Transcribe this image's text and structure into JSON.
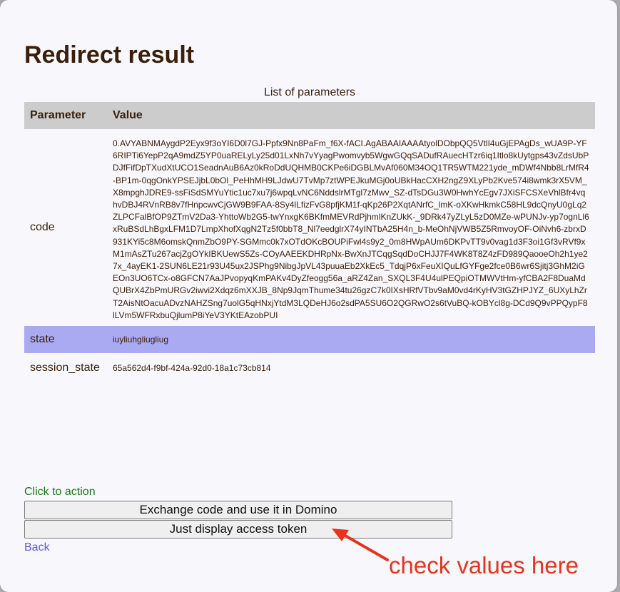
{
  "page": {
    "title": "Redirect result"
  },
  "table": {
    "caption": "List of parameters",
    "headers": [
      "Parameter",
      "Value"
    ],
    "rows": [
      {
        "name": "code",
        "value": "0.AVYABNMAygdP2Eyx9f3oYI6D0l7GJ-Ppfx9Nn8PaFm_f6X-fACI.AgABAAIAAAAtyolDObpQQ5VtlI4uGjEPAgDs_wUA9P-YF6RIPTi6YepP2qA9mdZ5YP0uaRELyLy25d01LxNh7vYyagPwomvyb5WgwGQqSADufRAuecHTzr6iq1Itlo8kUytgps43vZdsUbPDJfFifDpTXudXtUCO1SeadnAuB6Az0kRoDdUQHMB0CKPe6iDGBLMvAf060M34OQ1TR5WTM221yde_mDWf4Nbb8LrMfR4-BP1m-0qgOnkYPSEJjbL0bOl_PeHhMH9LJdwU7TvMp7ztWPEJkuMGj0oUBkHacCXH2ngZ9XLyPb2Kve574i8wmk3rX5VM_X8mpghJDRE9-ssFiSdSMYuYtic1uc7xu7j6wpqLvNC6NddslrMTgl7zMwv_SZ-dTsDGu3W0HwhYcEgv7JXiSFCSXeVhlBfr4vqhvDBJ4RVnRB8v7fHnpcwvCjGW9B9FAA-8Sy4lLfizFvG8pfjKM1f-qKp26P2XqtANrfC_lmK-oXKwHkmkC58HL9dcQnyU0gLq2ZLPCFalBfOP9ZTmV2Da3-YhttoWb2G5-twYnxgK6BKfmMEVRdPjhmlKnZUkK-_9DRk47yZLyL5zD0MZe-wPUNJv-yp7ognLl6xRuBSdLhBgxLFM1D7LmpXhofXqgN2Tz5f0bbT8_Nl7eedglrX74yINTbA25H4n_b-MeOhNjVWB5Z5RmvoyOF-OiNvh6-zbrxD931KYi5c8M6omskQnmZbO9PY-SGMmc0k7xOTdOKcBOUPiFwl4s9y2_0m8HWpAUm6DKPvTT9v0vag1d3F3oi1Gf3vRVf9xM1mAsZTu267acjZgOYkIBKUewS5Zs-COyAAEEKDHRpNx-BwXnJTCqgSqdDoCHJJ7F4WK8T8Z4zFD989QaooeOh2h1ye27x_4ayEK1-2SUN6LE21r93U45ux2JSPhg9NibgJpVL43puuaEb2XkEc5_TdqjP6xFeuXIQuLfGYFge2fce0B6wr6Sjitj3GhM2iGEOn3UO6TCx-o8GFCN7AaJPvopyqKmPAKv4DyZfeogg56a_aRZ4Zan_SXQL3F4U4ulPEQpiOTMWVtHm-yfCBA2F8DuaMdQUBrX4ZbPmURGv2iwvi2Xdqz6mXXJB_8Np9JqmThume34tu26gzC7k0IXsHRfVTbv9aM0vd4rKyHV3tGZHPJYZ_6UXyLhZrT2AisNtOacuADvzNAHZSng7uolG5qHNxjYtdM3LQDeHJ6o2sdPA5SU6O2QGRwO2s6tVuBQ-kOBYcl8g-DCd9Q9vPPQypF8lLVm5WFRxbuQjlumP8iYeV3YKtEAzobPUI"
      },
      {
        "name": "state",
        "value": "iuyliuhgliugliug"
      },
      {
        "name": "session_state",
        "value": "65a562d4-f9bf-424a-92d0-18a1c73cb814"
      }
    ]
  },
  "actions": {
    "label": "Click to action",
    "exchange_button": "Exchange code and use it in Domino",
    "display_button": "Just display access token",
    "back_link": "Back"
  },
  "annotation": {
    "text": "check values here",
    "color": "#e8331c"
  },
  "colors": {
    "header_bg": "#cccccc",
    "highlight_row": "#aaaaf3",
    "text": "#3b1f0a",
    "action_label": "#157a15",
    "link": "#5a5ae6"
  }
}
